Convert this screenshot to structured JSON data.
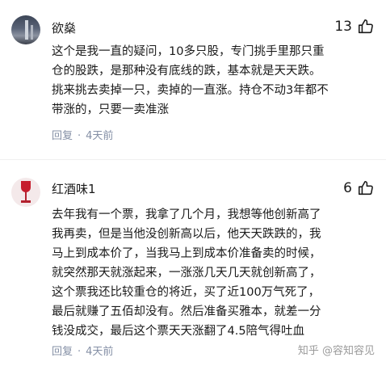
{
  "comments": [
    {
      "username": "欲燊",
      "like_count": "13",
      "lines": [
        "这个是我一直的疑问，10多只股，专门挑手里那只重",
        "仓的股跌，是那种没有底线的跌，基本就是天天跌。",
        "挑来挑去卖掉一只，卖掉的一直涨。持仓不动3年都不",
        "带涨的，只要一卖准涨"
      ],
      "reply_label": "回复",
      "separator": "·",
      "time": "4天前"
    },
    {
      "username": "红酒味1",
      "like_count": "6",
      "lines": [
        "去年我有一个票，我拿了几个月，我想等他创新高了",
        "我再卖，但是当他没创新高以后，他天天跌跌的，我",
        "马上到成本价了，当我马上到成本价准备卖的时候，",
        "就突然那天就涨起来，一涨涨几天几天就创新高了，",
        "这个票我还比较重仓的将近，买了近100万气死了，",
        "最后就赚了五佰却没有。然后准备买雅本，就差一分",
        "钱没成交，最后这个票天天涨翻了4.5陪气得吐血"
      ],
      "reply_label": "回复",
      "separator": "·",
      "time": "4天前"
    }
  ],
  "watermark": "知乎 @容知容见",
  "icons": {
    "like": "thumbs-up-icon"
  },
  "colors": {
    "text": "#1a1a1a",
    "meta": "#8590a6",
    "watermark": "#9a9a9a"
  }
}
